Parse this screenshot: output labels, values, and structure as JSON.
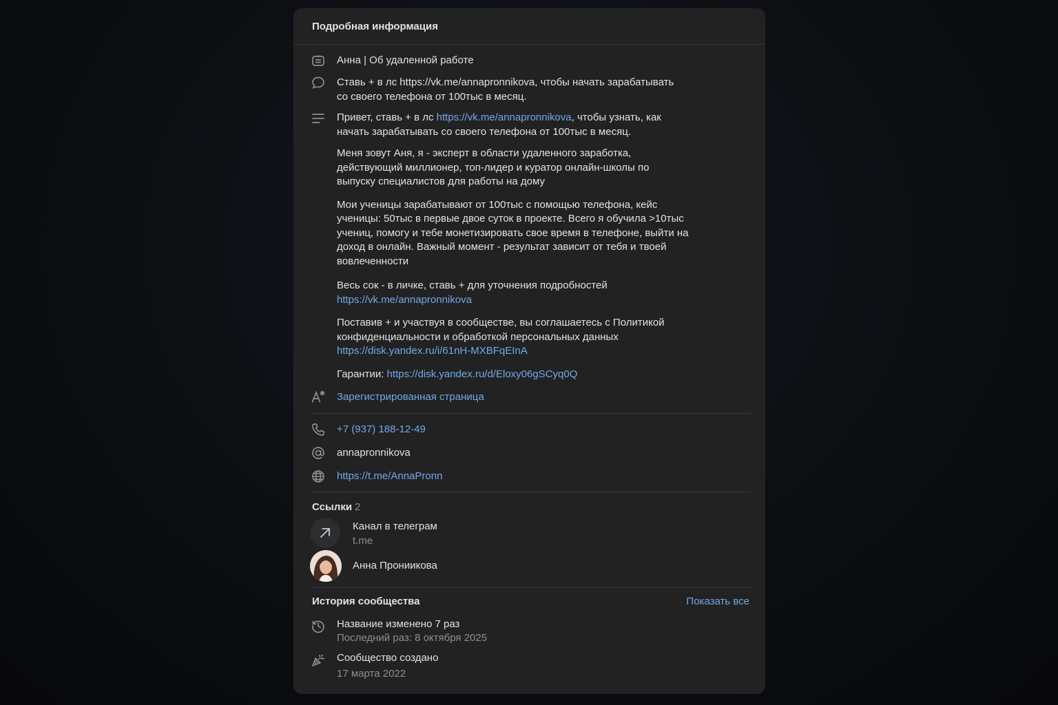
{
  "panel": {
    "title": "Подробная информация"
  },
  "info": {
    "status": "Анна | Об удаленной работе",
    "short_desc_line1": "Ставь + в лс https://vk.me/annapronnikova, чтобы начать зарабатывать",
    "short_desc_line2": "со своего телефона от 100тыс в месяц.",
    "desc_p1_pre": "Привет, ставь + в лс ",
    "desc_p1_link": "https://vk.me/annapronnikova",
    "desc_p1_post_line1": ", чтобы узнать, как",
    "desc_p1_line2": "начать зарабатывать со своего телефона от 100тыс в месяц.",
    "desc_p2_line1": "Меня зовут Аня, я - эксперт в области удаленного заработка,",
    "desc_p2_line2": "действующий миллионер, топ-лидер и куратор онлайн-школы по",
    "desc_p2_line3": "выпуску специалистов для работы на дому",
    "desc_p3_line1": "Мои ученицы зарабатывают от 100тыс с помощью телефона, кейс",
    "desc_p3_line2": "ученицы: 50тыс в первые двое суток в проекте. Всего я обучила >10тыс",
    "desc_p3_line3": "учениц, помогу и тебе монетизировать свое время в телефоне, выйти на",
    "desc_p3_line4": "доход в онлайн. Важный момент - результат зависит от тебя и твоей",
    "desc_p3_line5": "вовлеченности",
    "desc_p4_line1": "Весь сок - в личке, ставь + для уточнения подробностей",
    "desc_p4_link": "https://vk.me/annapronnikova",
    "desc_p5_line1": "Поставив + и участвуя в сообществе, вы соглашаетесь с Политикой",
    "desc_p5_line2": "конфиденциальности и обработкой персональных данных",
    "desc_p5_link": "https://disk.yandex.ru/i/61nH-MXBFqEInA",
    "desc_p6_label": "Гарантии: ",
    "desc_p6_link": "https://disk.yandex.ru/d/Eloxy06gSCyq0Q",
    "registered": "Зарегистрированная страница"
  },
  "contacts": {
    "phone": "+7 (937) 188-12-49",
    "username": "annapronnikova",
    "site": "https://t.me/AnnaPronn"
  },
  "links": {
    "title": "Ссылки",
    "count": "2",
    "items": [
      {
        "title": "Канал в телеграм",
        "subtitle": "t.me"
      },
      {
        "title": "Анна Прониикова"
      }
    ]
  },
  "history": {
    "title": "История сообщества",
    "show_all": "Показать все",
    "items": [
      {
        "title": "Название изменено 7 раз",
        "subtitle": "Последний раз: 8 октября 2025"
      },
      {
        "title": "Сообщество создано",
        "subtitle": "17 марта 2022"
      }
    ]
  },
  "colors": {
    "panel_bg": "#222222",
    "link": "#71aaeb",
    "muted": "#8b8f94",
    "text": "#e1e3e6"
  },
  "icons": {
    "status": "status-badge-icon",
    "short_desc": "speech-bubble-icon",
    "description": "text-lines-icon",
    "registered": "font-asterisk-icon",
    "phone": "phone-icon",
    "username": "at-sign-icon",
    "site": "globe-icon",
    "external_link": "arrow-up-right-icon",
    "history_rename": "history-clock-icon",
    "history_created": "party-popper-icon"
  }
}
